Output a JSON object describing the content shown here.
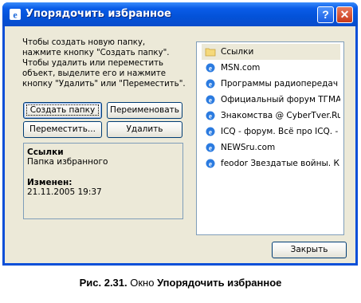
{
  "window": {
    "title": "Упорядочить избранное",
    "help_label": "?",
    "close_label": "✕"
  },
  "instructions": {
    "text": "Чтобы создать новую папку, нажмите кнопку \"Создать папку\". Чтобы удалить или переместить объект, выделите его и нажмите кнопку \"Удалить\" или \"Переместить\"."
  },
  "buttons": {
    "create_folder": "Создать папку",
    "rename": "Переименовать",
    "move": "Переместить...",
    "delete": "Удалить",
    "close": "Закрыть"
  },
  "info": {
    "name": "Ссылки",
    "type": "Папка избранного",
    "modified_label": "Изменен:",
    "modified_value": "21.11.2005 19:37"
  },
  "favorites": [
    {
      "label": "Ссылки",
      "icon": "folder-icon",
      "selected": true
    },
    {
      "label": "MSN.com",
      "icon": "ie-page-icon"
    },
    {
      "label": "Программы радиопередач",
      "icon": "ie-page-icon"
    },
    {
      "label": "Официальный форум TГМА...",
      "icon": "ie-page-icon"
    },
    {
      "label": "Знакомства @ CyberTver.Ru",
      "icon": "ie-page-icon"
    },
    {
      "label": "ICQ - форум. Всё про ICQ. - ...",
      "icon": "ie-page-icon"
    },
    {
      "label": "NEWSru.com",
      "icon": "ie-page-icon"
    },
    {
      "label": "feodor Звездатые войны. К...",
      "icon": "ie-page-icon"
    }
  ],
  "caption": {
    "prefix": "Рис. 2.31.",
    "middle": " Окно ",
    "title": "Упорядочить избранное"
  }
}
